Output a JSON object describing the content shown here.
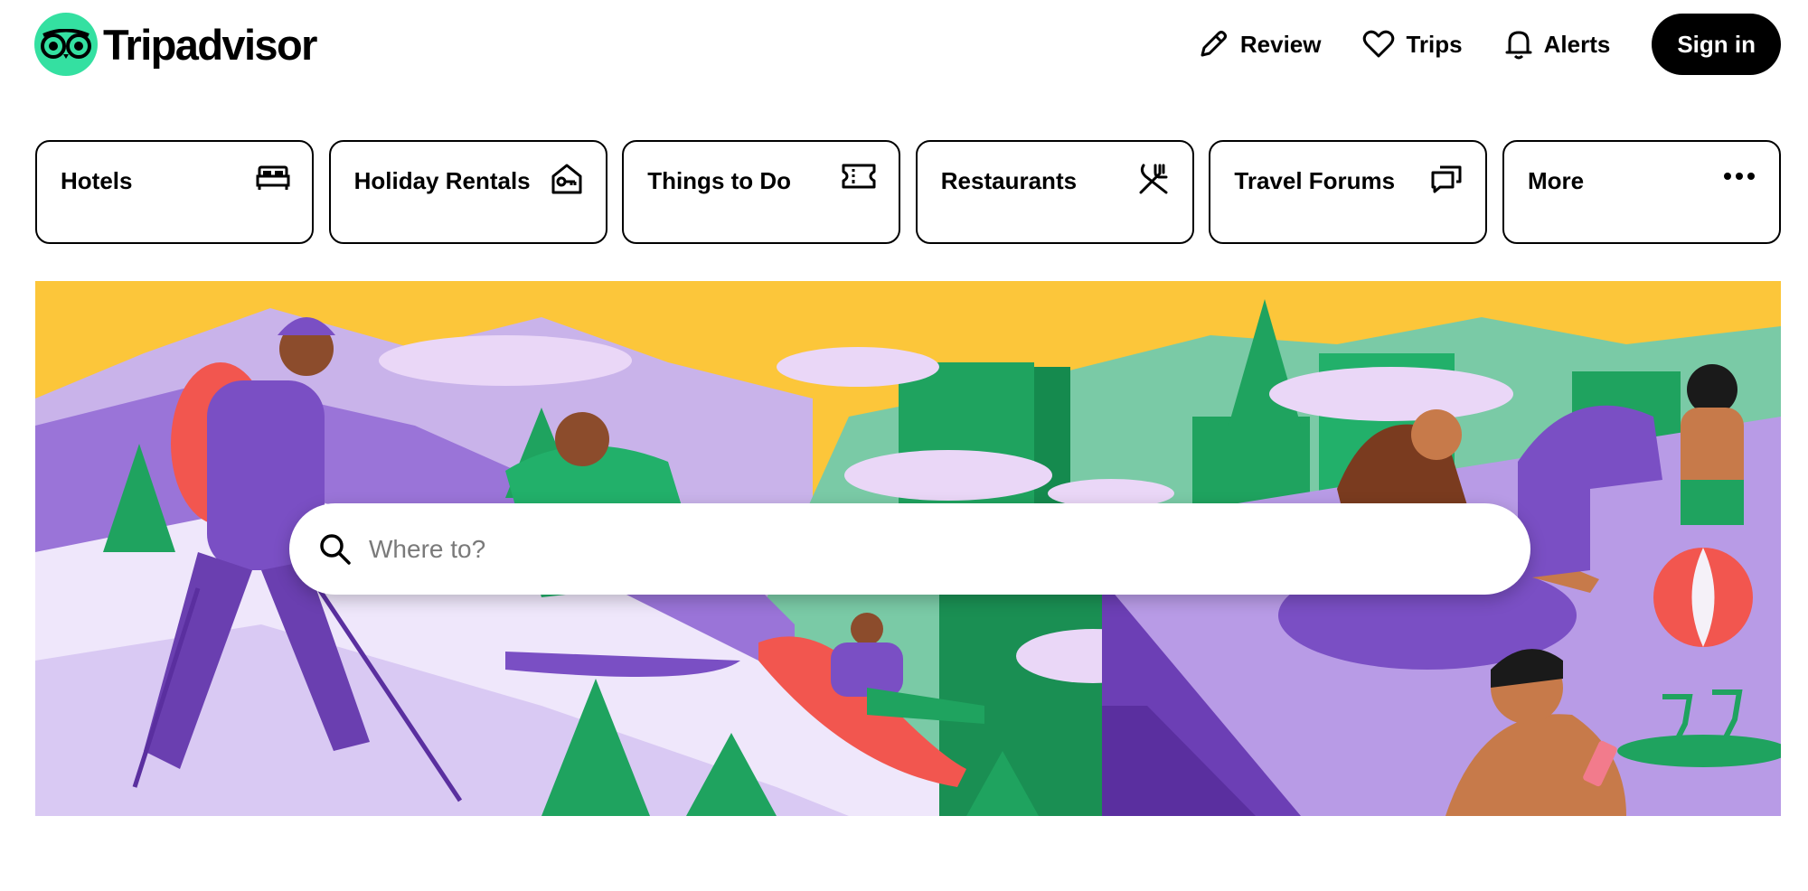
{
  "header": {
    "logo_text": "Tripadvisor",
    "nav": {
      "review": "Review",
      "trips": "Trips",
      "alerts": "Alerts",
      "signin": "Sign in"
    }
  },
  "categories": [
    {
      "label": "Hotels",
      "icon": "bed-icon"
    },
    {
      "label": "Holiday Rentals",
      "icon": "house-key-icon"
    },
    {
      "label": "Things to Do",
      "icon": "ticket-icon"
    },
    {
      "label": "Restaurants",
      "icon": "fork-knife-icon"
    },
    {
      "label": "Travel Forums",
      "icon": "chat-bubbles-icon"
    },
    {
      "label": "More",
      "icon": "more-dots-icon"
    }
  ],
  "search": {
    "placeholder": "Where to?",
    "icon": "search-icon"
  },
  "colors": {
    "brand_green": "#34e0a1",
    "hero_sky": "#fcc63a",
    "hero_purple": "#7a4fc4",
    "hero_green": "#1fa35f"
  }
}
